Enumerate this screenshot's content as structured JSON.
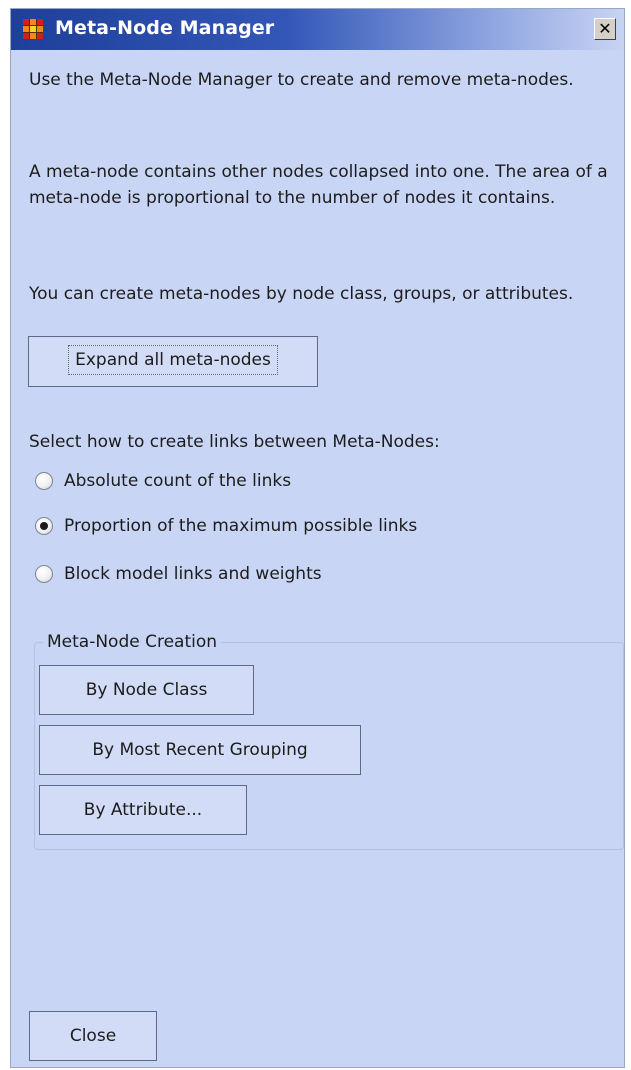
{
  "window": {
    "title": "Meta-Node Manager",
    "close_glyph": "✕"
  },
  "description": {
    "p1": "Use the Meta-Node Manager to create and remove meta-nodes.",
    "p2": "A meta-node contains other nodes collapsed into one. The area of a meta-node is proportional to the number of nodes it contains.",
    "p3": "You can create meta-nodes by node class, groups, or attributes."
  },
  "expand_button": {
    "label": "Expand all meta-nodes"
  },
  "links": {
    "prompt": "Select how to create links between Meta-Nodes:",
    "options": [
      {
        "label": "Absolute count of the links",
        "checked": false
      },
      {
        "label": "Proportion of the maximum possible links",
        "checked": true
      },
      {
        "label": "Block model links and weights",
        "checked": false
      }
    ]
  },
  "creation": {
    "title": "Meta-Node Creation",
    "buttons": [
      {
        "label": "By Node Class"
      },
      {
        "label": "By Most Recent Grouping"
      },
      {
        "label": "By Attribute..."
      }
    ]
  },
  "footer": {
    "close_label": "Close"
  },
  "colors": {
    "panel_bg": "#c9d5f4",
    "titlebar_start": "#1e3f9a",
    "button_bg": "#d3dcf6"
  },
  "icons": {
    "app": "meta-node-grid-icon",
    "close": "close-icon"
  }
}
